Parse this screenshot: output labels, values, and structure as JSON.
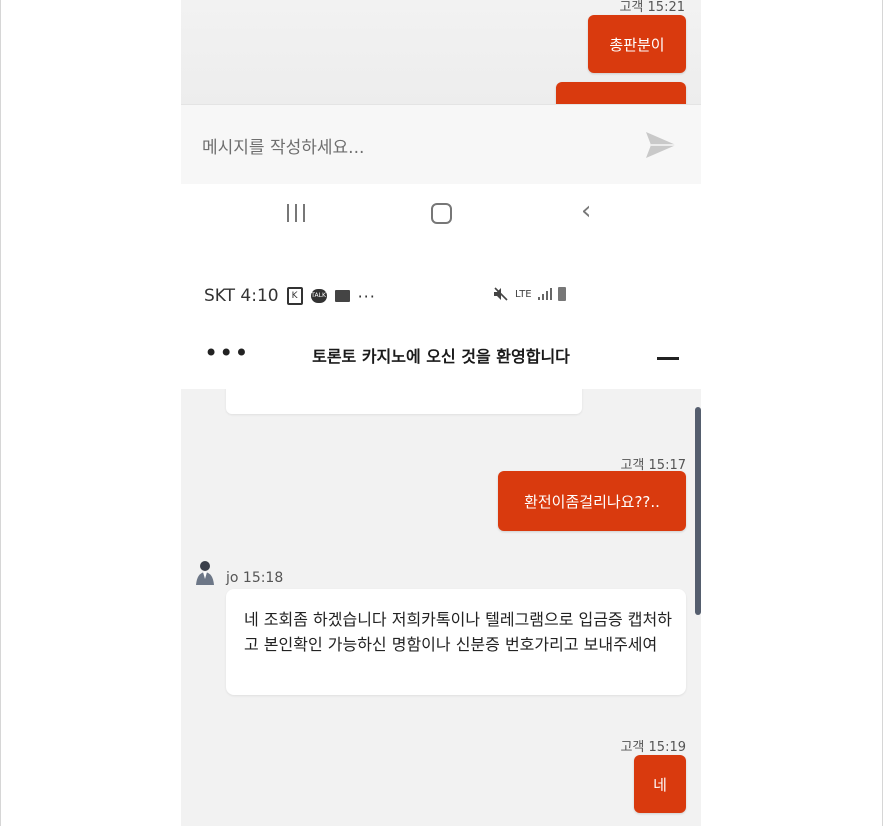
{
  "top_chat": {
    "timestamp": "고객 15:21",
    "message_1": "총판분이",
    "message_2": ""
  },
  "composer": {
    "placeholder": "메시지를 작성하세요..."
  },
  "status_bar": {
    "carrier_time": "SKT 4:10",
    "network": "LTE"
  },
  "chat_header": {
    "title": "토론토 카지노에 오신 것을 환영합니다",
    "menu": "•••"
  },
  "messages": [
    {
      "sender": "고객",
      "time": "고객 15:17",
      "text": "환전이좀걸리나요??.."
    },
    {
      "sender": "jo",
      "time": "jo 15:18",
      "text": "네 조회좀 하겠습니다 저희카톡이나 텔레그램으로 입금증 캡처하고 본인확인 가능하신 명함이나 신분증 번호가리고 보내주세여"
    },
    {
      "sender": "고객",
      "time": "고객 15:19",
      "text": "네"
    }
  ],
  "colors": {
    "accent": "#d93a0e",
    "background": "#f2f2f2"
  }
}
